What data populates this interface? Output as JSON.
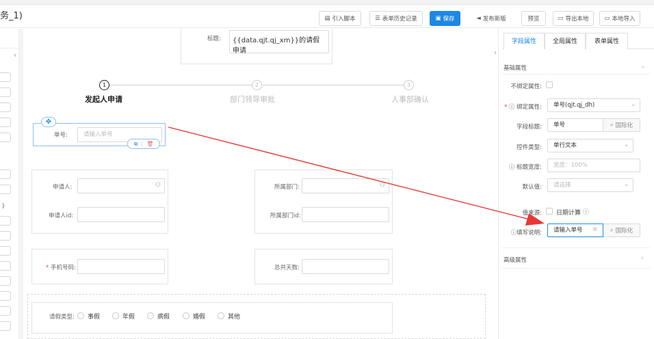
{
  "window_title": "务_1)",
  "toolbar": {
    "import_script": "引入脚本",
    "form_history": "表单历史记录",
    "save": "保存",
    "publish": "发布新版",
    "preview": "预览",
    "export_local": "导出本地",
    "import_local": "本地导入"
  },
  "form": {
    "title_label": "标题:",
    "title_value": "{{data.qjt.qj_xm}}的请假申请",
    "steps": [
      {
        "num": "1",
        "label": "发起人申请"
      },
      {
        "num": "2",
        "label": "部门领导审批"
      },
      {
        "num": "3",
        "label": "人事部确认"
      }
    ],
    "selected_field": {
      "label": "单号:",
      "placeholder": "请输入单号"
    },
    "applicant_label": "申请人:",
    "applicant_id_label": "申请人id:",
    "dept_label": "所属部门:",
    "dept_id_label": "所属部门id:",
    "phone_label": "手机号码:",
    "total_days_label": "总共天数:",
    "leave_type_label": "请假类型:",
    "leave_types": [
      "事假",
      "年假",
      "病假",
      "婚假",
      "其他"
    ],
    "left_stub": ")"
  },
  "right_panel": {
    "tabs": [
      "字段属性",
      "全局属性",
      "表单属性"
    ],
    "section_basic": "基础属性",
    "unbound_label": "不绑定属性:",
    "bind_label": "绑定属性:",
    "bind_value": "单号(qjt.qj_dh)",
    "field_title_label": "字段标题:",
    "field_title_value": "单号",
    "i18n": "国际化",
    "control_type_label": "控件类型:",
    "control_type_value": "单行文本",
    "title_width_label": "标题宽度:",
    "title_width_placeholder": "宽度：100%",
    "default_label": "默认值:",
    "default_placeholder": "请选择",
    "value_source_label": "值来源:",
    "date_calc": "日期计算",
    "fill_desc_label": "填写说明:",
    "fill_desc_value": "请输入单号",
    "section_advanced": "高级属性"
  },
  "colors": {
    "primary": "#1e88e5",
    "required": "#f44336",
    "annotation_arrow": "#e53935"
  }
}
